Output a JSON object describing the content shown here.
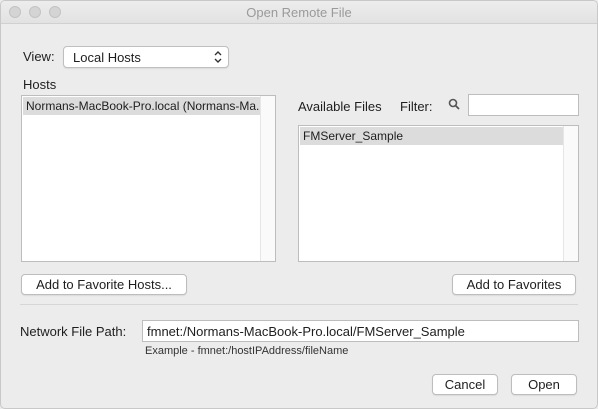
{
  "window": {
    "title": "Open Remote File"
  },
  "view": {
    "label": "View:",
    "selected": "Local Hosts"
  },
  "hosts": {
    "label": "Hosts",
    "items": [
      "Normans-MacBook-Pro.local (Normans-Ma..."
    ]
  },
  "files": {
    "label": "Available Files",
    "filter_label": "Filter:",
    "filter_value": "",
    "items": [
      "FMServer_Sample"
    ]
  },
  "buttons": {
    "add_favorite_hosts": "Add to Favorite Hosts...",
    "add_favorites": "Add to Favorites",
    "cancel": "Cancel",
    "open": "Open"
  },
  "path": {
    "label": "Network File Path:",
    "value": "fmnet:/Normans-MacBook-Pro.local/FMServer_Sample",
    "example": "Example - fmnet:/hostIPAddress/fileName"
  },
  "icons": {
    "filter": "magnifier-icon",
    "popup": "updown-arrows-icon"
  }
}
